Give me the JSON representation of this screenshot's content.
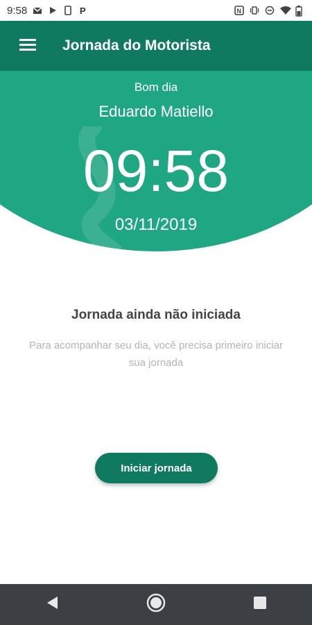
{
  "status_bar": {
    "time": "9:58",
    "left_icons": [
      "gmail-icon",
      "play-store-icon",
      "phone-icon",
      "parking-icon"
    ],
    "right_icons": [
      "nfc-icon",
      "vibrate-icon",
      "dnd-icon",
      "wifi-icon",
      "battery-icon"
    ]
  },
  "app_bar": {
    "title": "Jornada do Motorista",
    "menu_icon": "menu-icon"
  },
  "hero": {
    "greeting": "Bom dia",
    "user_name": "Eduardo Matiello",
    "time": "09:58",
    "date": "03/11/2019"
  },
  "main": {
    "status_title": "Jornada ainda não iniciada",
    "status_description": "Para acompanhar seu dia, você precisa primeiro iniciar sua jornada",
    "start_button_label": "Iniciar jornada"
  },
  "nav_bar": {
    "buttons": [
      "back-icon",
      "home-icon",
      "recents-icon"
    ]
  },
  "colors": {
    "primary_dark": "#0f7a5f",
    "primary": "#1fa683",
    "nav_bar": "#3c3f43"
  }
}
